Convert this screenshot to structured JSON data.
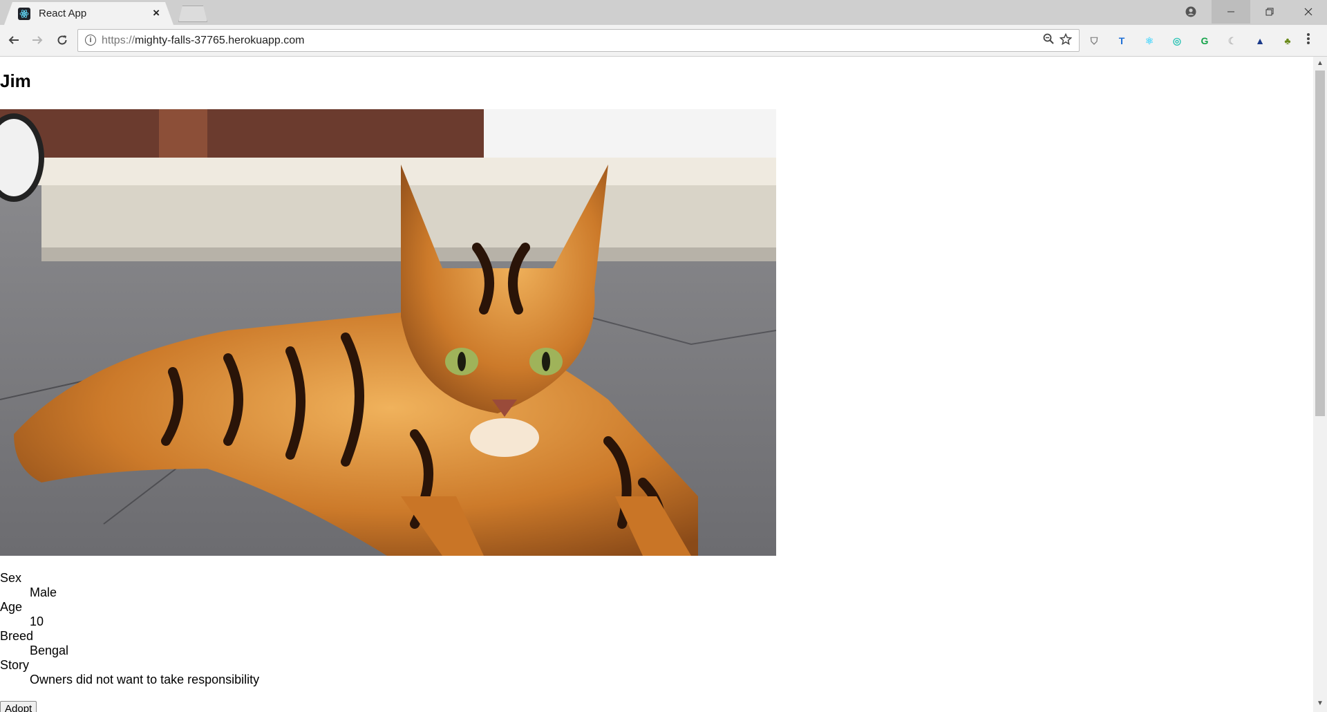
{
  "browser": {
    "tab_title": "React App",
    "tab_close": "×",
    "url_scheme": "https://",
    "url_host": "mighty-falls-37765.herokuapp.com",
    "extensions": [
      {
        "name": "shield-extension-icon",
        "glyph": "⛉",
        "color": "#7a7a7a"
      },
      {
        "name": "typewriter-extension-icon",
        "glyph": "T",
        "color": "#1d6fd6"
      },
      {
        "name": "react-devtools-extension-icon",
        "glyph": "⚛",
        "color": "#61dafb"
      },
      {
        "name": "color-extension-icon",
        "glyph": "◎",
        "color": "#2ec4b6"
      },
      {
        "name": "grammarly-extension-icon",
        "glyph": "G",
        "color": "#15a34a"
      },
      {
        "name": "moon-extension-icon",
        "glyph": "☾",
        "color": "#bdbdbd"
      },
      {
        "name": "drive-extension-icon",
        "glyph": "▲",
        "color": "#1a3a8a"
      },
      {
        "name": "plant-extension-icon",
        "glyph": "♣",
        "color": "#6a8a1a"
      }
    ]
  },
  "pet": {
    "name": "Jim",
    "details": [
      {
        "label": "Sex",
        "value": "Male"
      },
      {
        "label": "Age",
        "value": "10"
      },
      {
        "label": "Breed",
        "value": "Bengal"
      },
      {
        "label": "Story",
        "value": "Owners did not want to take responsibility"
      }
    ],
    "adopt_label": "Adopt"
  },
  "colors": {
    "chrome_bg": "#cfcfcf",
    "toolbar_bg": "#f2f2f2"
  }
}
